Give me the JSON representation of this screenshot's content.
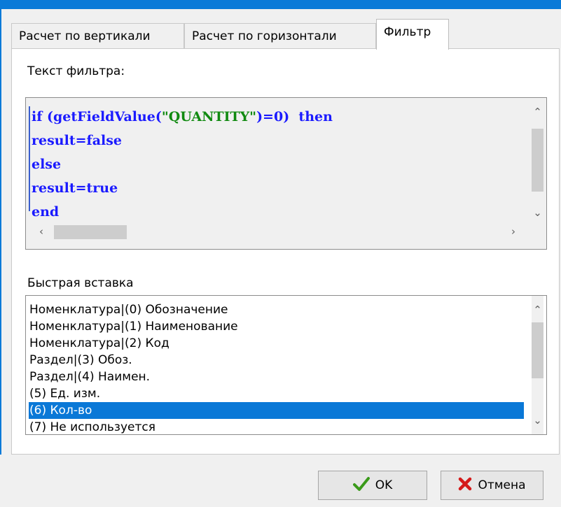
{
  "tabs": [
    {
      "label": "Расчет по вертикали"
    },
    {
      "label": "Расчет по горизонтали"
    },
    {
      "label": "Фильтр"
    }
  ],
  "filter": {
    "label": "Текст фильтра:",
    "code_lines": [
      {
        "parts": [
          "if",
          " (getFieldValue(",
          "\"QUANTITY\"",
          ")=0)",
          "  then"
        ]
      },
      {
        "text": "result=false"
      },
      {
        "text": "else"
      },
      {
        "text": "result=true"
      },
      {
        "text": "end"
      }
    ]
  },
  "quick_insert": {
    "label": "Быстрая вставка",
    "items": [
      "Номенклатура|(0) Обозначение",
      "Номенклатура|(1) Наименование",
      "Номенклатура|(2) Код",
      "Раздел|(3) Обоз.",
      "Раздел|(4) Наимен.",
      "(5) Ед. изм.",
      "(6) Кол-во",
      "(7) Не используется"
    ],
    "selected_index": 6
  },
  "buttons": {
    "ok_label": "OK",
    "cancel_label": "Отмена"
  },
  "colors": {
    "accent": "#0a78d7",
    "keyword": "#1a1aff",
    "string": "#108a10",
    "ok_check": "#3a9a1a",
    "cancel_x": "#d41a1a"
  }
}
